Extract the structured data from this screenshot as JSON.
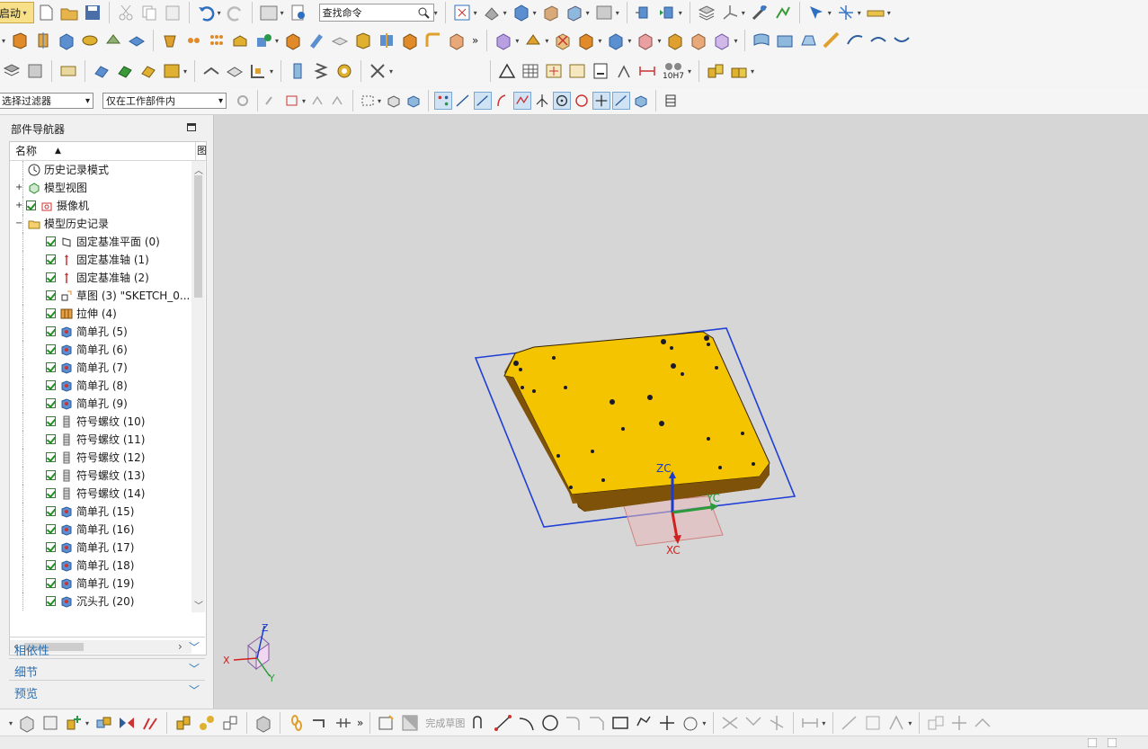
{
  "toolbar": {
    "start_label": "启动",
    "search_placeholder": "查找命令",
    "selection_filter": "选择过滤器",
    "selection_scope": "仅在工作部件内",
    "more_marker": "»",
    "hole_callout_label": "10H7"
  },
  "navigator": {
    "title": "部件导航器",
    "column_name": "名称",
    "column_extra": "图",
    "nodes": [
      {
        "label": "历史记录模式",
        "kind": "clock",
        "level": 0,
        "expander": ""
      },
      {
        "label": "模型视图",
        "kind": "views",
        "level": 0,
        "expander": "+"
      },
      {
        "label": "摄像机",
        "kind": "camera",
        "level": 0,
        "expander": "+",
        "checked": true
      },
      {
        "label": "模型历史记录",
        "kind": "folder",
        "level": 0,
        "expander": "−"
      },
      {
        "label": "固定基准平面 (0)",
        "kind": "plane",
        "level": 1,
        "checked": true
      },
      {
        "label": "固定基准轴 (1)",
        "kind": "axis",
        "level": 1,
        "checked": true
      },
      {
        "label": "固定基准轴 (2)",
        "kind": "axis",
        "level": 1,
        "checked": true
      },
      {
        "label": "草图 (3) \"SKETCH_0...",
        "kind": "sketch",
        "level": 1,
        "checked": true
      },
      {
        "label": "拉伸 (4)",
        "kind": "extrude",
        "level": 1,
        "checked": true
      },
      {
        "label": "简单孔 (5)",
        "kind": "hole",
        "level": 1,
        "checked": true
      },
      {
        "label": "简单孔 (6)",
        "kind": "hole",
        "level": 1,
        "checked": true
      },
      {
        "label": "简单孔 (7)",
        "kind": "hole",
        "level": 1,
        "checked": true
      },
      {
        "label": "简单孔 (8)",
        "kind": "hole",
        "level": 1,
        "checked": true
      },
      {
        "label": "简单孔 (9)",
        "kind": "hole",
        "level": 1,
        "checked": true
      },
      {
        "label": "符号螺纹 (10)",
        "kind": "thread",
        "level": 1,
        "checked": true
      },
      {
        "label": "符号螺纹 (11)",
        "kind": "thread",
        "level": 1,
        "checked": true
      },
      {
        "label": "符号螺纹 (12)",
        "kind": "thread",
        "level": 1,
        "checked": true
      },
      {
        "label": "符号螺纹 (13)",
        "kind": "thread",
        "level": 1,
        "checked": true
      },
      {
        "label": "符号螺纹 (14)",
        "kind": "thread",
        "level": 1,
        "checked": true
      },
      {
        "label": "简单孔 (15)",
        "kind": "hole",
        "level": 1,
        "checked": true
      },
      {
        "label": "简单孔 (16)",
        "kind": "hole",
        "level": 1,
        "checked": true
      },
      {
        "label": "简单孔 (17)",
        "kind": "hole",
        "level": 1,
        "checked": true
      },
      {
        "label": "简单孔 (18)",
        "kind": "hole",
        "level": 1,
        "checked": true
      },
      {
        "label": "简单孔 (19)",
        "kind": "hole",
        "level": 1,
        "checked": true
      },
      {
        "label": "沉头孔 (20)",
        "kind": "hole",
        "level": 1,
        "checked": true
      }
    ],
    "panels": [
      "相依性",
      "细节",
      "预览"
    ]
  },
  "viewport": {
    "csys_labels": {
      "x": "XC",
      "y": "YC",
      "z": "ZC"
    },
    "triad_labels": {
      "x": "X",
      "y": "Y",
      "z": "Z"
    },
    "part_color": "#f5c400",
    "selection_color": "#1f3fd6"
  },
  "bottom_toolbar": {
    "finish_sketch": "完成草图",
    "more_marker": "»"
  }
}
